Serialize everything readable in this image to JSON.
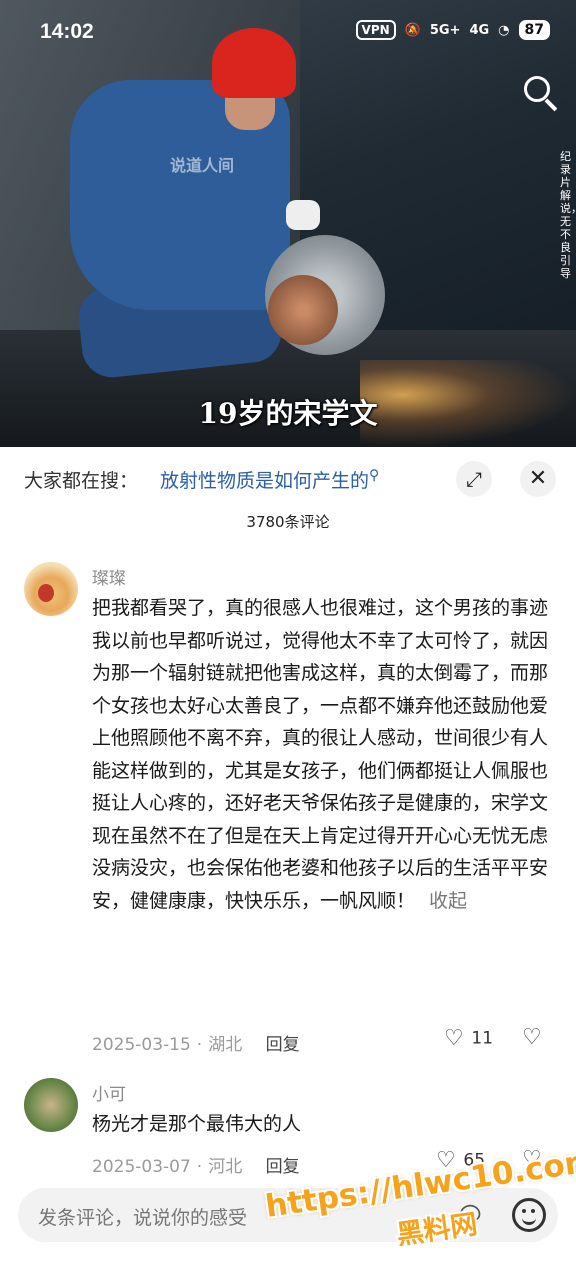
{
  "status_bar": {
    "time": "14:02",
    "vpn": "VPN",
    "net1": "5G+",
    "net2": "4G",
    "battery": "87"
  },
  "video": {
    "watermark": "说道人间",
    "side_note": "纪录片解说，无不良引导",
    "subtitle": "19岁的宋学文"
  },
  "search_trend": {
    "label": "大家都在搜：",
    "query": "放射性物质是如何产生的"
  },
  "comments_count": "3780条评论",
  "comments": [
    {
      "username": "璨璨",
      "text": "把我都看哭了，真的很感人也很难过，这个男孩的事迹我以前也早都听说过，觉得他太不幸了太可怜了，就因为那一个辐射链就把他害成这样，真的太倒霉了，而那个女孩也太好心太善良了，一点都不嫌弃他还鼓励他爱上他照顾他不离不弃，真的很让人感动，世间很少有人能这样做到的，尤其是女孩子，他们俩都挺让人佩服也挺让人心疼的，还好老天爷保佑孩子是健康的，宋学文现在虽然不在了但是在天上肯定过得开开心心无忧无虑没病没灾，也会保佑他老婆和他孩子以后的生活平平安安，健健康康，快快乐乐，一帆风顺！",
      "collapse": "收起",
      "date": "2025-03-15",
      "location": "湖北",
      "reply": "回复",
      "likes": "11"
    },
    {
      "username": "小可",
      "text": "杨光才是那个最伟大的人",
      "date": "2025-03-07",
      "location": "河北",
      "reply": "回复",
      "likes": "65"
    }
  ],
  "input": {
    "placeholder": "发条评论，说说你的感受"
  },
  "overlay_watermark": {
    "url": "https://hlwc10.com",
    "name": "黑料网"
  }
}
